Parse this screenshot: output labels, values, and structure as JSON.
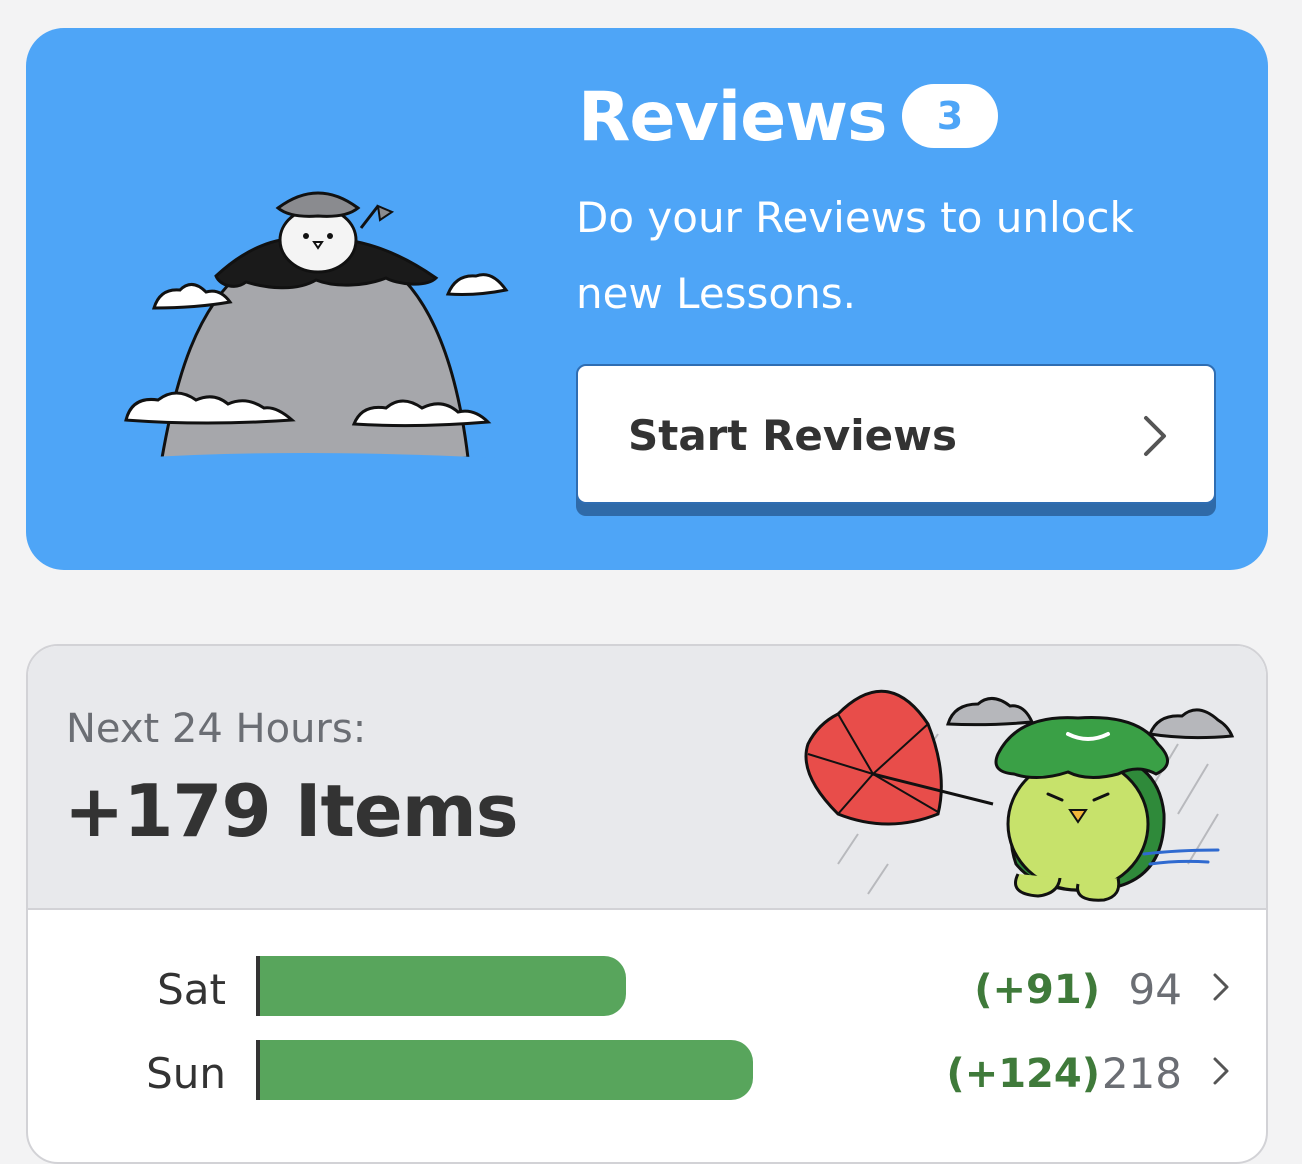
{
  "reviews": {
    "title": "Reviews",
    "count": "3",
    "description": "Do your Reviews to unlock new Lessons.",
    "button_label": "Start Reviews"
  },
  "forecast": {
    "label": "Next 24 Hours:",
    "total": "+179 Items",
    "days": [
      {
        "day": "Sat",
        "new": "(+91)",
        "total": "94",
        "fill": 0.43
      },
      {
        "day": "Sun",
        "new": "(+124)",
        "total": "218",
        "fill": 0.58
      }
    ]
  },
  "colors": {
    "reviews_blue": "#4ea5f7",
    "bar_green": "#58a55c",
    "new_green": "#3f7a3a"
  }
}
